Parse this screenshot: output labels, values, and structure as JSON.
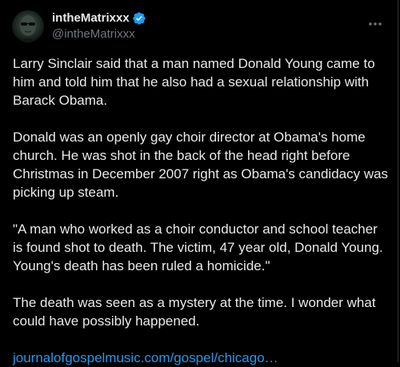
{
  "author": {
    "display_name": "intheMatrixxx",
    "handle": "@intheMatrixxx",
    "avatar_icon": "avatar-icon",
    "verified_icon": "verified-badge-icon",
    "verified_color": "#1d9bf0"
  },
  "menu_icon": "more-icon",
  "post": {
    "paragraphs": [
      "Larry Sinclair said  that a man named Donald Young came to him and told him that he also had a sexual relationship with Barack Obama.",
      "Donald was an openly gay choir director at Obama's home church. He was shot in the back of the head right before Christmas in December 2007 right as Obama's candidacy was picking up steam.",
      "\"A man who worked as a choir conductor and school teacher is found shot to death. The victim, 47 year old, Donald Young. Young's death has been ruled a homicide.\"",
      "The death was seen as a mystery at the time. I wonder what could have possibly happened."
    ],
    "link_text": "journalofgospelmusic.com/gospel/chicago…",
    "link_color": "#1d9bf0"
  },
  "colors": {
    "background": "#000000",
    "text": "#e7e9ea",
    "secondary_text": "#71767b"
  }
}
